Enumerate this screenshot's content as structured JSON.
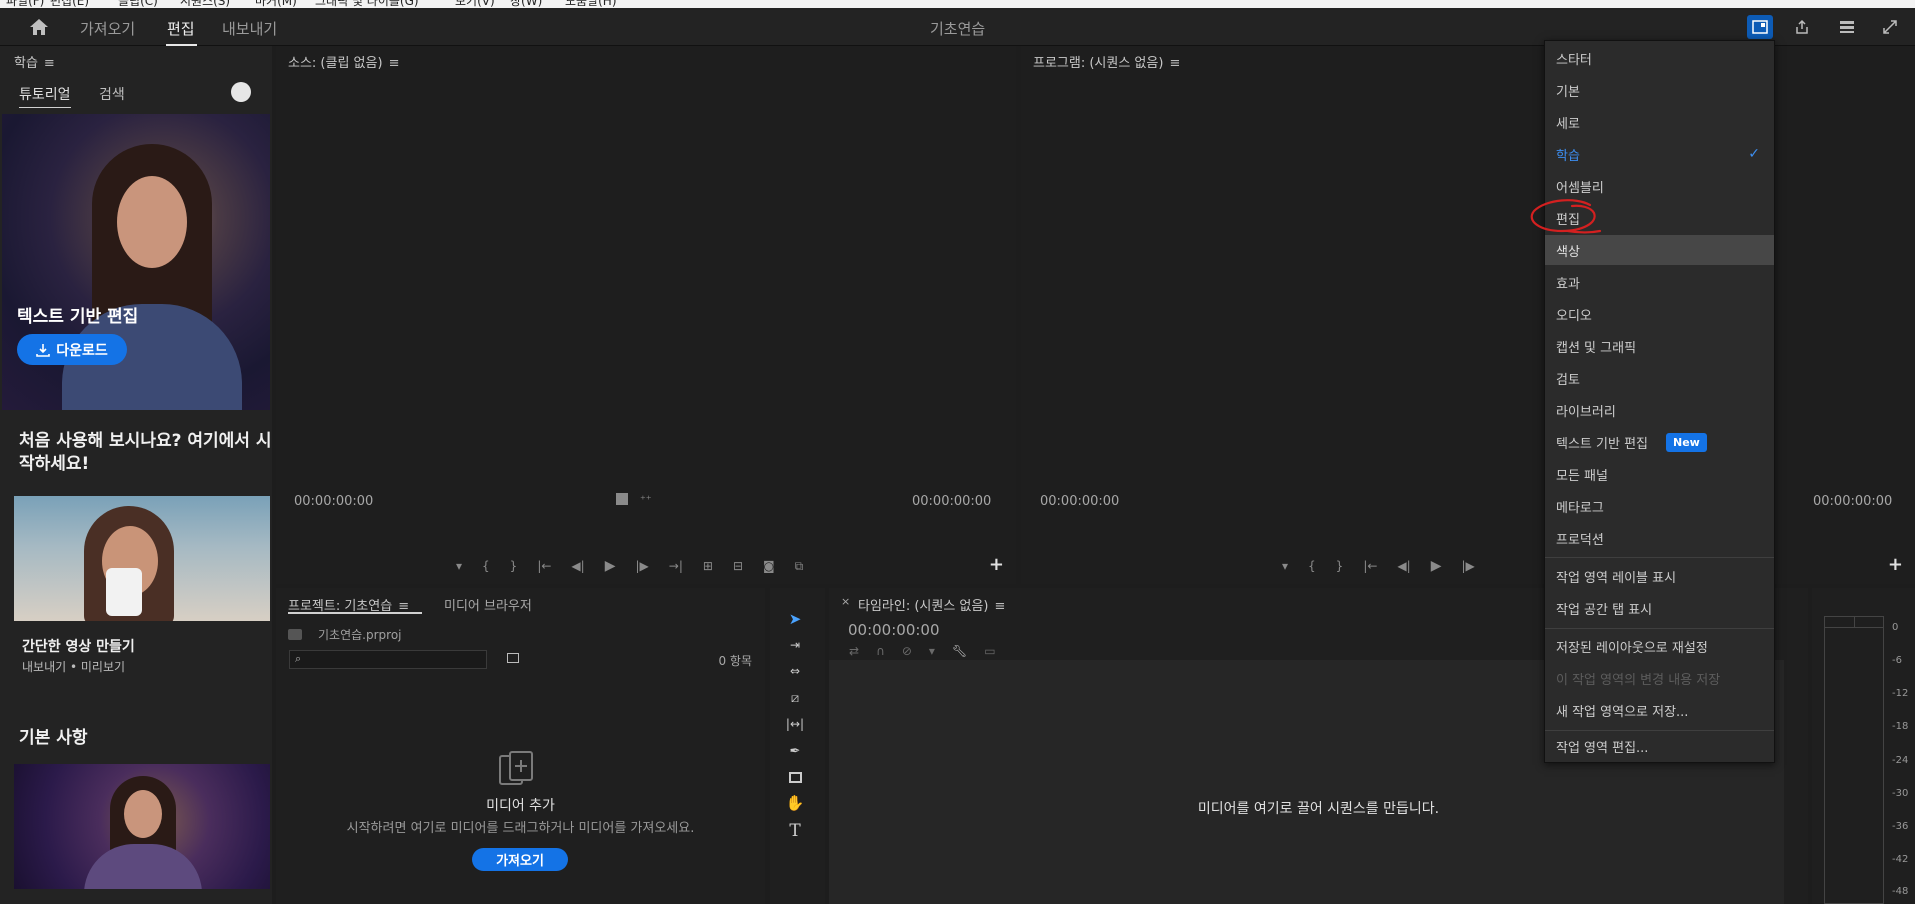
{
  "os_menu": [
    "파일(F)",
    "편집(E)",
    "클립(C)",
    "시퀀스(S)",
    "마커(M)",
    "그래픽 및 타이틀(G)",
    "보기(V)",
    "창(W)",
    "도움말(H)"
  ],
  "header": {
    "tabs": [
      "가져오기",
      "편집",
      "내보내기"
    ],
    "active_tab": "편집",
    "project_title": "기초연습"
  },
  "learn": {
    "title": "학습",
    "tabs": [
      "튜토리얼",
      "검색"
    ],
    "hero_title": "텍스트 기반 편집",
    "hero_button": "다운로드",
    "heading": "처음 사용해 보시나요? 여기에서 시작하세요!",
    "card1_title": "간단한 영상 만들기",
    "card1_sub": "내보내기 • 미리보기",
    "heading2": "기본 사항"
  },
  "source": {
    "title": "소스: (클립 없음)",
    "tc_left": "00:00:00:00",
    "tc_right": "00:00:00:00"
  },
  "program": {
    "title": "프로그램: (시퀀스 없음)",
    "tc_left": "00:00:00:00",
    "tc_right": "00:00:00:00"
  },
  "project": {
    "tab_project": "프로젝트: 기초연습",
    "tab_media": "미디어 브라우저",
    "file": "기초연습.prproj",
    "count": "0 항목",
    "add_title": "미디어 추가",
    "add_sub": "시작하려면 여기로 미디어를 드래그하거나 미디어를 가져오세요.",
    "import_button": "가져오기"
  },
  "timeline": {
    "title": "타임라인: (시퀀스 없음)",
    "timecode": "00:00:00:00",
    "drop_text": "미디어를 여기로 끌어 시퀀스를 만듭니다."
  },
  "meters": {
    "labels": [
      "0",
      "-6",
      "-12",
      "-18",
      "-24",
      "-30",
      "-36",
      "-42",
      "-48"
    ]
  },
  "workspace_menu": {
    "items": [
      "스타터",
      "기본",
      "세로",
      "학습",
      "어셈블리",
      "편집",
      "색상",
      "효과",
      "오디오",
      "캡션 및 그래픽",
      "검토",
      "라이브러리",
      "텍스트 기반 편집",
      "모든 패널",
      "메타로그",
      "프로덕션"
    ],
    "selected": "학습",
    "hovered": "색상",
    "new_badge": "New",
    "options": [
      "작업 영역 레이블 표시",
      "작업 공간 탭 표시"
    ],
    "actions": [
      "저장된 레이아웃으로 재설정",
      "이 작업 영역의 변경 내용 저장",
      "새 작업 영역으로 저장..."
    ],
    "disabled_action": "이 작업 영역의 변경 내용 저장",
    "edit": "작업 영역 편집...",
    "annotation_color": "#d42020",
    "accent_color": "#1473e6"
  }
}
